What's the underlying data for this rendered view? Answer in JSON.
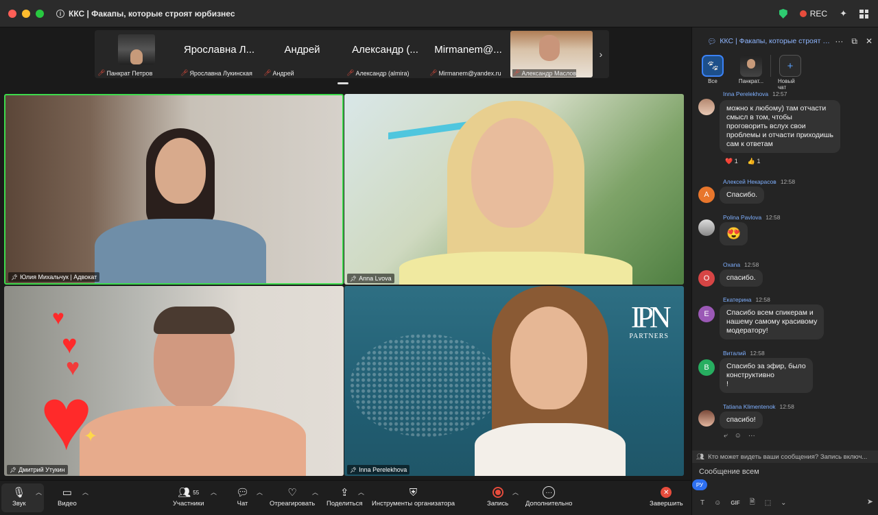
{
  "window": {
    "title": "ККС | Факапы, которые строят юрбизнес",
    "rec_label": "REC"
  },
  "strip": {
    "thumbs": [
      {
        "name_big": "",
        "label": "Панкрат Петров"
      },
      {
        "name_big": "Ярославна Л...",
        "label": "Ярославна Лукинская"
      },
      {
        "name_big": "Андрей",
        "label": "Андрей"
      },
      {
        "name_big": "Александр (...",
        "label": "Александр (almira)"
      },
      {
        "name_big": "Mirmanem@...",
        "label": "Mirmanem@yandex.ru"
      },
      {
        "name_big": "",
        "label": "Александр Маслов"
      }
    ]
  },
  "tiles": [
    {
      "label": "Юлия Михальчук | Адвокат"
    },
    {
      "label": "Anna Lvova"
    },
    {
      "label": "Дмитрий Утукин"
    },
    {
      "label": "Inna Perelekhova"
    }
  ],
  "logo": {
    "mark": "IPN",
    "text": "PARTNERS"
  },
  "toolbar": {
    "audio": "Звук",
    "video": "Видео",
    "participants": "Участники",
    "participants_count": "55",
    "chat": "Чат",
    "react": "Отреагировать",
    "share": "Поделиться",
    "host_tools": "Инструменты организатора",
    "record": "Запись",
    "more": "Дополнительно",
    "end": "Завершить"
  },
  "chat": {
    "title": "ККС | Факапы, которые строят юр...",
    "tabs": {
      "all": "Все",
      "person": "Панкрат...",
      "new_chat": "Новый чат"
    },
    "messages": [
      {
        "author": "Inna Perelekhova",
        "time": "12:57",
        "text_lines": [
          "можно к любому) там отчасти",
          "смысл в том, чтобы",
          "проговорить вслух свои",
          "проблемы и отчасти приходишь",
          "сам к ответам"
        ],
        "reactions": [
          {
            "emoji": "❤️",
            "count": "1"
          },
          {
            "emoji": "👍",
            "count": "1"
          }
        ]
      },
      {
        "author": "Алексей Некарасов",
        "time": "12:58",
        "initial": "А",
        "text_lines": [
          "Спасибо."
        ]
      },
      {
        "author": "Polina Pavlova",
        "time": "12:58",
        "text_lines": [
          "😍"
        ]
      },
      {
        "author": "Oxana",
        "time": "12:58",
        "initial": "O",
        "text_lines": [
          "спасибо."
        ]
      },
      {
        "author": "Екатерина",
        "time": "12:58",
        "initial": "E",
        "text_lines": [
          "Спасибо всем спикерам и",
          "нашему самому красивому",
          "модератору!"
        ]
      },
      {
        "author": "Виталий",
        "time": "12:58",
        "initial": "B",
        "text_lines": [
          "Спасибо за эфир, было",
          "конструктивно",
          "!"
        ]
      },
      {
        "author": "Tatiana Klimentenok",
        "time": "12:58",
        "text_lines": [
          "спасибо!"
        ]
      }
    ],
    "notice": "Кто может видеть ваши сообщения? Запись включ...",
    "compose_placeholder": "Сообщение всем",
    "lang": "РУ",
    "gif": "GIF"
  },
  "colors": {
    "active_speaker": "#3ddc4c",
    "avatar_orange": "#e8762c",
    "avatar_red": "#d64545",
    "avatar_purple": "#9b59b6",
    "avatar_green": "#27ae60",
    "accent_blue": "#2d6ff0"
  }
}
